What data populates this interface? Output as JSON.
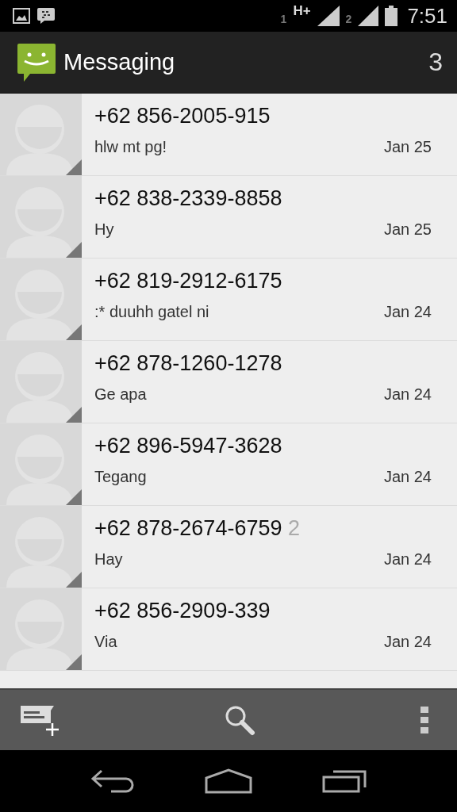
{
  "status_bar": {
    "sim1": "1",
    "network": "H+",
    "sim2": "2",
    "time": "7:51"
  },
  "action_bar": {
    "title": "Messaging",
    "unread_count": "3"
  },
  "conversations": [
    {
      "sender": "+62 856-2005-915",
      "snippet": "hlw mt pg!",
      "date": "Jan 25"
    },
    {
      "sender": "+62 838-2339-8858",
      "snippet": "Hy",
      "date": "Jan 25"
    },
    {
      "sender": "+62 819-2912-6175",
      "snippet": ":* duuhh gatel ni",
      "date": "Jan 24"
    },
    {
      "sender": "+62 878-1260-1278",
      "snippet": "Ge apa",
      "date": "Jan 24"
    },
    {
      "sender": "+62 896-5947-3628",
      "snippet": "Tegang",
      "date": "Jan 24"
    },
    {
      "sender": "+62 878-2674-6759",
      "count": "2",
      "snippet": "Hay",
      "date": "Jan 24"
    },
    {
      "sender": "+62 856-2909-339",
      "snippet": "Via",
      "date": "Jan 24"
    }
  ]
}
